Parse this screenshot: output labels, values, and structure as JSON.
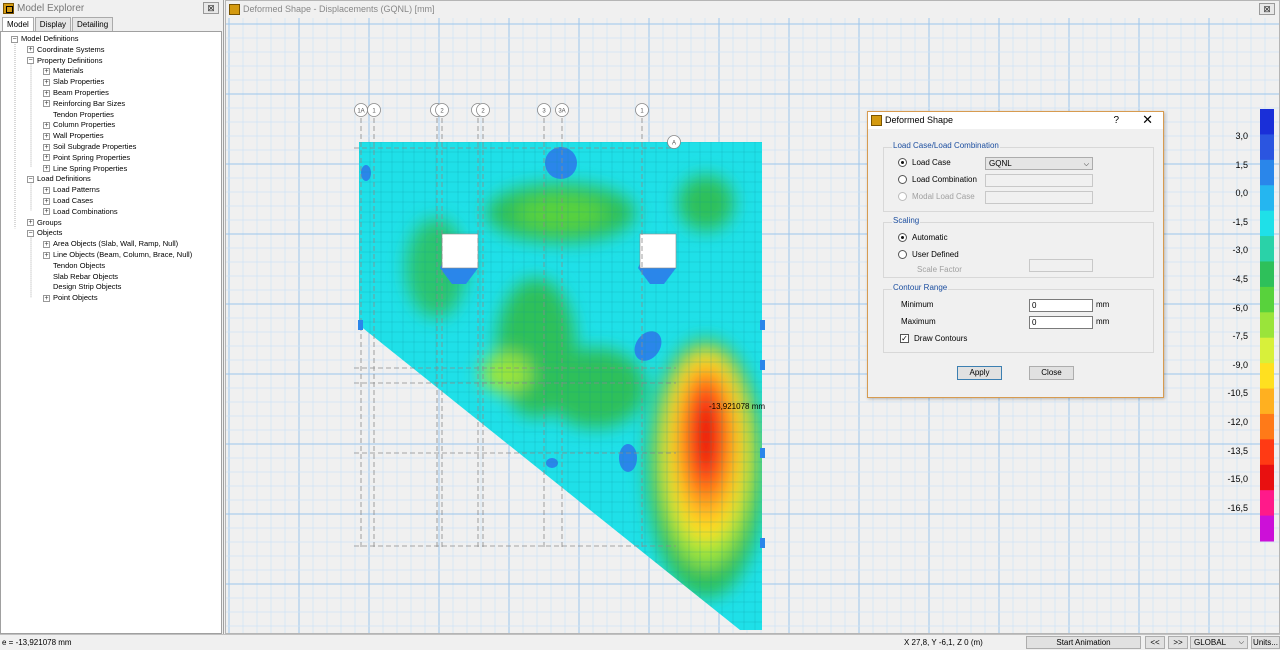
{
  "explorer": {
    "title": "Model Explorer",
    "close": "⊠",
    "tabs": [
      "Model",
      "Display",
      "Detailing"
    ],
    "tree": [
      {
        "label": "Model Definitions",
        "level": 0,
        "expander": "−"
      },
      {
        "label": "Coordinate Systems",
        "level": 1,
        "expander": "+"
      },
      {
        "label": "Property Definitions",
        "level": 1,
        "expander": "−"
      },
      {
        "label": "Materials",
        "level": 2,
        "expander": "+"
      },
      {
        "label": "Slab Properties",
        "level": 2,
        "expander": "+"
      },
      {
        "label": "Beam Properties",
        "level": 2,
        "expander": "+"
      },
      {
        "label": "Reinforcing Bar Sizes",
        "level": 2,
        "expander": "+"
      },
      {
        "label": "Tendon Properties",
        "level": 2,
        "expander": ""
      },
      {
        "label": "Column Properties",
        "level": 2,
        "expander": "+"
      },
      {
        "label": "Wall Properties",
        "level": 2,
        "expander": "+"
      },
      {
        "label": "Soil Subgrade Properties",
        "level": 2,
        "expander": "+"
      },
      {
        "label": "Point Spring Properties",
        "level": 2,
        "expander": "+"
      },
      {
        "label": "Line Spring Properties",
        "level": 2,
        "expander": "+"
      },
      {
        "label": "Load Definitions",
        "level": 1,
        "expander": "−"
      },
      {
        "label": "Load Patterns",
        "level": 2,
        "expander": "+"
      },
      {
        "label": "Load Cases",
        "level": 2,
        "expander": "+"
      },
      {
        "label": "Load Combinations",
        "level": 2,
        "expander": "+"
      },
      {
        "label": "Groups",
        "level": 1,
        "expander": "+"
      },
      {
        "label": "Objects",
        "level": 1,
        "expander": "−"
      },
      {
        "label": "Area Objects (Slab, Wall, Ramp, Null)",
        "level": 2,
        "expander": "+"
      },
      {
        "label": "Line Objects (Beam, Column, Brace, Null)",
        "level": 2,
        "expander": "+"
      },
      {
        "label": "Tendon Objects",
        "level": 2,
        "expander": ""
      },
      {
        "label": "Slab Rebar Objects",
        "level": 2,
        "expander": ""
      },
      {
        "label": "Design Strip Objects",
        "level": 2,
        "expander": ""
      },
      {
        "label": "Point Objects",
        "level": 2,
        "expander": "+"
      }
    ]
  },
  "main": {
    "title": "Deformed Shape - Displacements (GQNL)  [mm]",
    "close": "⊠",
    "max_annotation": "-13,921078 mm",
    "grid_bubbles": [
      "1A",
      "1",
      "2",
      "2",
      "2",
      "2",
      "3",
      "3A",
      "1",
      "A"
    ],
    "legend": {
      "labels": [
        "3,0",
        "1,5",
        "0,0",
        "-1,5",
        "-3,0",
        "-4,5",
        "-6,0",
        "-7,5",
        "-9,0",
        "-10,5",
        "-12,0",
        "-13,5",
        "-15,0",
        "-16,5"
      ],
      "colors": [
        "#1a2fd8",
        "#2b55e0",
        "#2a86ea",
        "#25b6f0",
        "#1fe0e8",
        "#2ad2a8",
        "#2ec05a",
        "#58d23c",
        "#9ae43a",
        "#d8f03a",
        "#ffe020",
        "#ffb020",
        "#ff7a18",
        "#ff3a14",
        "#e81010",
        "#ff1a8a",
        "#cc10d8"
      ]
    }
  },
  "dialog": {
    "title": "Deformed Shape",
    "help": "?",
    "close": "✕",
    "load_group_title": "Load Case/Load Combination",
    "load_case_label": "Load Case",
    "load_case_value": "GQNL",
    "load_combination_label": "Load Combination",
    "modal_label": "Modal Load Case",
    "scaling_title": "Scaling",
    "automatic_label": "Automatic",
    "user_defined_label": "User Defined",
    "scale_factor_label": "Scale Factor",
    "contour_title": "Contour Range",
    "minimum_label": "Minimum",
    "minimum_value": "0",
    "maximum_label": "Maximum",
    "maximum_value": "0",
    "unit": "mm",
    "draw_contours_label": "Draw Contours",
    "check": "✓",
    "apply": "Apply",
    "close_button": "Close"
  },
  "status": {
    "left": "e = -13,921078 mm",
    "coords": "X 27,8,  Y -6,1,  Z 0  (m)",
    "start_animation": "Start Animation",
    "prev": "<<",
    "next": ">>",
    "coord_system": "GLOBAL",
    "units": "Units..."
  }
}
